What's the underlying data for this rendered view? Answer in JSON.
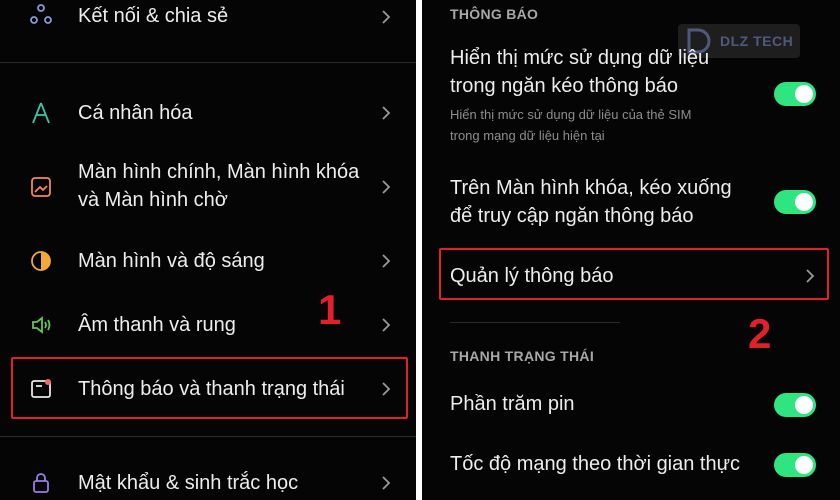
{
  "left": {
    "items": [
      {
        "label": "Kết nối & chia sẻ",
        "icon": "connection-share-icon",
        "icon_color": "#8a9bd8"
      },
      {
        "label": "Cá nhân hóa",
        "icon": "personalization-icon",
        "icon_color": "#3bc6a6"
      },
      {
        "label": "Màn hình chính, Màn hình khóa\nvà Màn hình chờ",
        "icon": "home-lock-screen-icon",
        "icon_color": "#f08a5a"
      },
      {
        "label": "Màn hình và độ sáng",
        "icon": "display-brightness-icon",
        "icon_color": "#f3a93a"
      },
      {
        "label": "Âm thanh và rung",
        "icon": "sound-vibration-icon",
        "icon_color": "#67c25a"
      },
      {
        "label": "Thông báo và thanh trạng thái",
        "icon": "notification-status-bar-icon",
        "icon_color": "#f06a6a"
      },
      {
        "label": "Mật khẩu & sinh trắc học",
        "icon": "password-biometrics-icon",
        "icon_color": "#9a7ee8"
      }
    ],
    "step_number": "1"
  },
  "right": {
    "notifications_header": "THÔNG BÁO",
    "data_usage_title": "Hiển thị mức sử dụng dữ liệu\ntrong ngăn kéo thông báo",
    "data_usage_desc": "Hiển thị mức sử dụng dữ liệu của thẻ SIM\ntrong mạng dữ liệu hiện tại",
    "data_usage_on": true,
    "lockscreen_title": "Trên Màn hình khóa, kéo xuống\nđể truy cập ngăn thông báo",
    "lockscreen_on": true,
    "manage_label": "Quản lý thông báo",
    "status_bar_header": "THANH TRẠNG THÁI",
    "battery_percent_label": "Phần trăm pin",
    "battery_percent_on": true,
    "network_speed_label": "Tốc độ mạng theo thời gian thực",
    "network_speed_on": true,
    "step_number": "2"
  },
  "watermark": {
    "text": "DLZ TECH",
    "logo": "dlz-tech-logo"
  },
  "colors": {
    "accent_toggle": "#2ee580",
    "highlight": "#e0202a",
    "background": "#050505"
  }
}
